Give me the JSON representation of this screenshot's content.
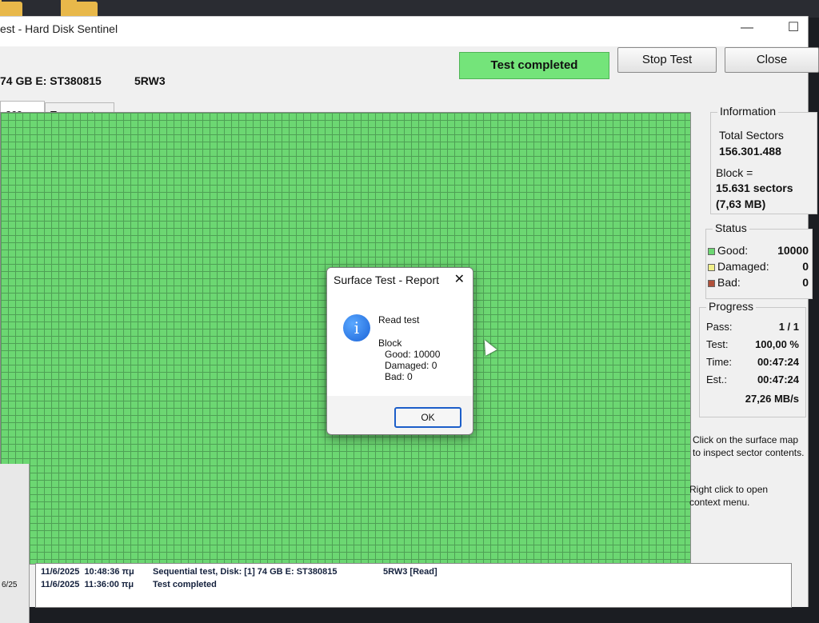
{
  "window": {
    "title": "est - Hard Disk Sentinel",
    "minimize_glyph": "—",
    "maximize_glyph": "☐"
  },
  "header": {
    "disk_name": "74 GB E: ST380815",
    "disk_model": "5RW3",
    "status": "Test completed",
    "stop_button": "Stop Test",
    "close_button": "Close"
  },
  "tabs": [
    {
      "label": "ace map",
      "active": true
    },
    {
      "label": "Temperature and transfer speed",
      "active": false
    }
  ],
  "information": {
    "title": "Information",
    "total_sectors_label": "Total Sectors",
    "total_sectors_value": "156.301.488",
    "block_label": "Block =",
    "block_value": "15.631 sectors",
    "block_size": "(7,63 MB)"
  },
  "status": {
    "title": "Status",
    "good_label": "Good:",
    "good_value": "10000",
    "damaged_label": "Damaged:",
    "damaged_value": "0",
    "bad_label": "Bad:",
    "bad_value": "0",
    "colors": {
      "good": "#6cd772",
      "damaged": "#f1f08a",
      "bad": "#b0503a"
    }
  },
  "progress": {
    "title": "Progress",
    "pass_label": "Pass:",
    "pass_value": "1 / 1",
    "test_label": "Test:",
    "test_value": "100,00 %",
    "time_label": "Time:",
    "time_value": "00:47:24",
    "est_label": "Est.:",
    "est_value": "00:47:24",
    "speed": "27,26 MB/s"
  },
  "hints": {
    "surface": "Click on the surface map to inspect sector contents.",
    "context": "Right click to open context menu."
  },
  "log": [
    {
      "time": "11/6/2025  10:48:36 πμ",
      "text": "Sequential test, Disk: [1] 74 GB E: ST380815",
      "extra": "5RW3 [Read]"
    },
    {
      "time": "11/6/2025  11:36:00 πμ",
      "text": "Test completed",
      "extra": ""
    }
  ],
  "left_strip_text": "6/25",
  "dialog": {
    "title": "Surface Test - Report",
    "close_glyph": "✕",
    "icon_glyph": "i",
    "heading": "Read test",
    "block": "Block",
    "good": "Good: 10000",
    "damaged": "Damaged: 0",
    "bad": "Bad: 0",
    "ok": "OK"
  }
}
